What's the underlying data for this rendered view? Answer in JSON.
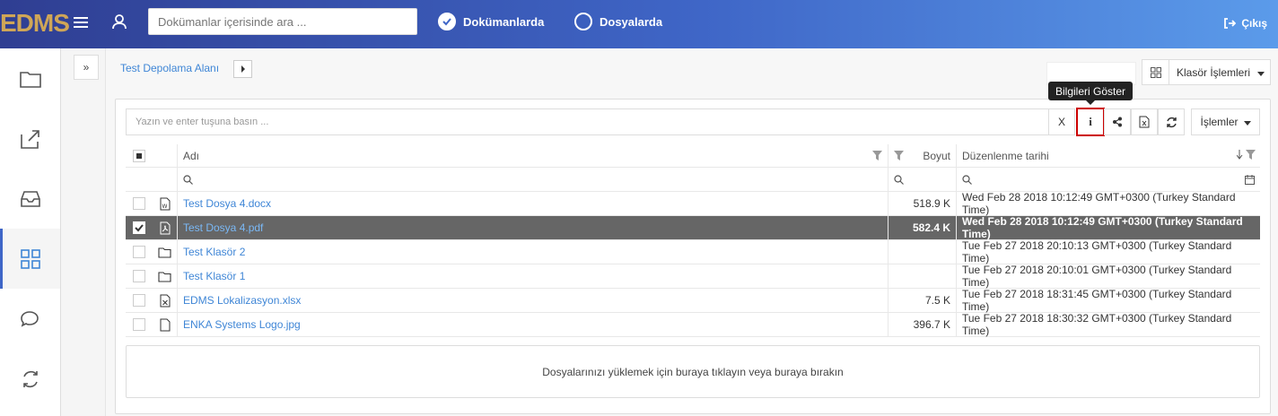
{
  "app": {
    "logo": "EDMS"
  },
  "header": {
    "search_placeholder": "Dokümanlar içerisinde ara ...",
    "radio_documents": "Dokümanlarda",
    "radio_files": "Dosyalarda",
    "exit": "Çıkış"
  },
  "breadcrumb": {
    "root": "Test Depolama Alanı"
  },
  "toolbar": {
    "folder_ops": "Klasör İşlemleri",
    "filter_placeholder": "Yazın ve enter tuşuna basın ...",
    "clear": "X",
    "tooltip": "Bilgileri Göster",
    "ops": "İşlemler"
  },
  "table": {
    "headers": {
      "name": "Adı",
      "size": "Boyut",
      "date": "Düzenlenme tarihi"
    },
    "rows": [
      {
        "name": "Test Dosya 4.docx",
        "size": "518.9 K",
        "date": "Wed Feb 28 2018 10:12:49 GMT+0300 (Turkey Standard Time)",
        "icon": "word-file-icon",
        "selected": false
      },
      {
        "name": "Test Dosya 4.pdf",
        "size": "582.4 K",
        "date": "Wed Feb 28 2018 10:12:49 GMT+0300 (Turkey Standard Time)",
        "icon": "pdf-file-icon",
        "selected": true
      },
      {
        "name": "Test Klasör 2",
        "size": "",
        "date": "Tue Feb 27 2018 20:10:13 GMT+0300 (Turkey Standard Time)",
        "icon": "folder-icon",
        "selected": false
      },
      {
        "name": "Test Klasör 1",
        "size": "",
        "date": "Tue Feb 27 2018 20:10:01 GMT+0300 (Turkey Standard Time)",
        "icon": "folder-icon",
        "selected": false
      },
      {
        "name": "EDMS Lokalizasyon.xlsx",
        "size": "7.5 K",
        "date": "Tue Feb 27 2018 18:31:45 GMT+0300 (Turkey Standard Time)",
        "icon": "excel-file-icon",
        "selected": false
      },
      {
        "name": "ENKA Systems Logo.jpg",
        "size": "396.7 K",
        "date": "Tue Feb 27 2018 18:30:32 GMT+0300 (Turkey Standard Time)",
        "icon": "file-icon",
        "selected": false
      }
    ]
  },
  "dropzone": {
    "text": "Dosyalarınızı yüklemek için buraya tıklayın veya buraya bırakın"
  }
}
